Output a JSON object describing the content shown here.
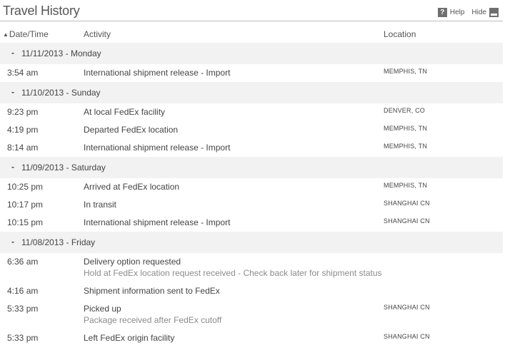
{
  "header": {
    "title": "Travel History",
    "help_label": "Help",
    "hide_label": "Hide",
    "help_icon": "question-icon",
    "hide_icon": "minimize-icon"
  },
  "columns": {
    "date": "Date/Time",
    "activity": "Activity",
    "location": "Location",
    "sort_indicator": "▲"
  },
  "groups": [
    {
      "dash": "-",
      "date": "11/11/2013",
      "day": "Monday",
      "rows": [
        {
          "time": "3:54 am",
          "activity": "International shipment release - Import",
          "detail": "",
          "location": "MEMPHIS, TN"
        }
      ]
    },
    {
      "dash": "-",
      "date": "11/10/2013",
      "day": "Sunday",
      "rows": [
        {
          "time": "9:23 pm",
          "activity": "At local FedEx facility",
          "detail": "",
          "location": "DENVER, CO"
        },
        {
          "time": "4:19 pm",
          "activity": "Departed FedEx location",
          "detail": "",
          "location": "MEMPHIS, TN"
        },
        {
          "time": "8:14 am",
          "activity": "International shipment release - Import",
          "detail": "",
          "location": "MEMPHIS, TN"
        }
      ]
    },
    {
      "dash": "-",
      "date": "11/09/2013",
      "day": "Saturday",
      "rows": [
        {
          "time": "10:25 pm",
          "activity": "Arrived at FedEx location",
          "detail": "",
          "location": "MEMPHIS, TN"
        },
        {
          "time": "10:17 pm",
          "activity": "In transit",
          "detail": "",
          "location": "SHANGHAI CN"
        },
        {
          "time": "10:15 pm",
          "activity": "International shipment release - Import",
          "detail": "",
          "location": "SHANGHAI CN"
        }
      ]
    },
    {
      "dash": "-",
      "date": "11/08/2013",
      "day": "Friday",
      "rows": [
        {
          "time": "6:36 am",
          "activity": "Delivery option requested",
          "detail": "Hold at FedEx location request received - Check back later for shipment status",
          "location": ""
        },
        {
          "time": "4:16 am",
          "activity": "Shipment information sent to FedEx",
          "detail": "",
          "location": ""
        },
        {
          "time": "5:33 pm",
          "activity": "Picked up",
          "detail": "Package received after FedEx cutoff",
          "location": "SHANGHAI CN"
        },
        {
          "time": "5:33 pm",
          "activity": "Left FedEx origin facility",
          "detail": "",
          "location": "SHANGHAI CN"
        }
      ]
    }
  ]
}
